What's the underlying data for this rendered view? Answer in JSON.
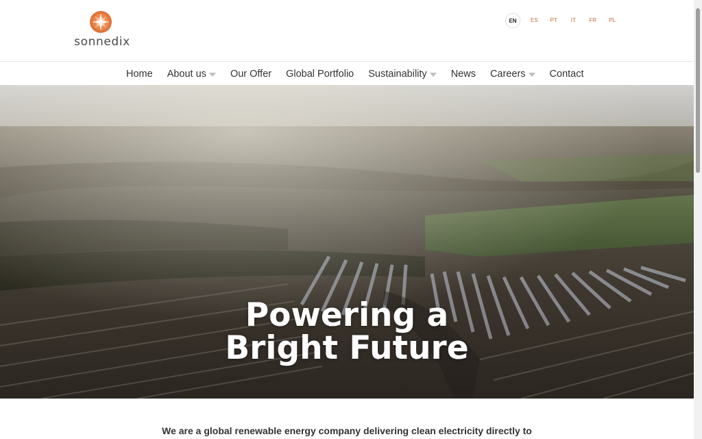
{
  "brand": {
    "name": "sonnedix",
    "accent": "#e0733a",
    "accent_dark": "#c95a28"
  },
  "languages": [
    {
      "code": "EN",
      "active": true
    },
    {
      "code": "ES",
      "active": false
    },
    {
      "code": "PT",
      "active": false
    },
    {
      "code": "IT",
      "active": false
    },
    {
      "code": "FR",
      "active": false
    },
    {
      "code": "PL",
      "active": false
    }
  ],
  "nav": {
    "items": [
      {
        "label": "Home",
        "has_dropdown": false
      },
      {
        "label": "About us",
        "has_dropdown": true
      },
      {
        "label": "Our Offer",
        "has_dropdown": false
      },
      {
        "label": "Global Portfolio",
        "has_dropdown": false
      },
      {
        "label": "Sustainability",
        "has_dropdown": true
      },
      {
        "label": "News",
        "has_dropdown": false
      },
      {
        "label": "Careers",
        "has_dropdown": true
      },
      {
        "label": "Contact",
        "has_dropdown": false
      }
    ]
  },
  "hero": {
    "title_line1": "Powering a",
    "title_line2": "Bright Future",
    "image": "aerial-solar-farm-photo"
  },
  "intro": {
    "text": "We are a global renewable energy company delivering clean electricity directly to"
  }
}
